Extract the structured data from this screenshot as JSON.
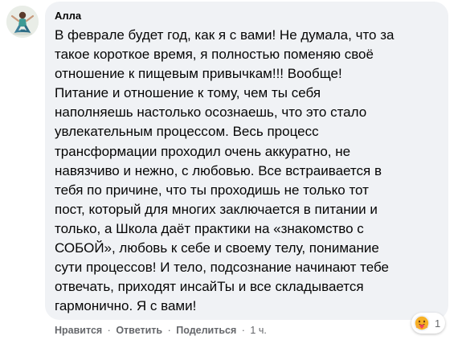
{
  "comment": {
    "author": "Алла",
    "lines": [
      "В феврале будет год, как я с вами! Не думала, что за",
      "такое короткое время, я полностью поменяю своё",
      "отношение к пищевым привычкам!!! Вообще!",
      "Питание и отношение к тому, чем ты себя",
      "наполняешь настолько осознаешь, что это стало",
      "увлекательным процессом. Весь процесс",
      "трансформации проходил очень аккуратно, не",
      "навязчиво и нежно, с любовью. Все встраивается в",
      "тебя по причине, что ты проходишь не только тот",
      "пост, который для многих заключается в питании и",
      "только, а Школа даёт практики на «знакомство с",
      "СОБОЙ», любовь к себе и своему телу, понимание",
      "сути процессов! И тело, подсознание начинают тебе",
      "отвечать, приходят инсайТы и все складывается",
      "гармонично. Я с вами!"
    ]
  },
  "actions": {
    "like": "Нравится",
    "reply": "Ответить",
    "share": "Поделиться",
    "separator": "·",
    "time": "1 ч."
  },
  "reaction": {
    "type": "care-emoji",
    "count": "1"
  },
  "colors": {
    "bubble": "#f0f2f5",
    "text": "#050505",
    "meta": "#65676b",
    "care_face": "#f7b125"
  }
}
